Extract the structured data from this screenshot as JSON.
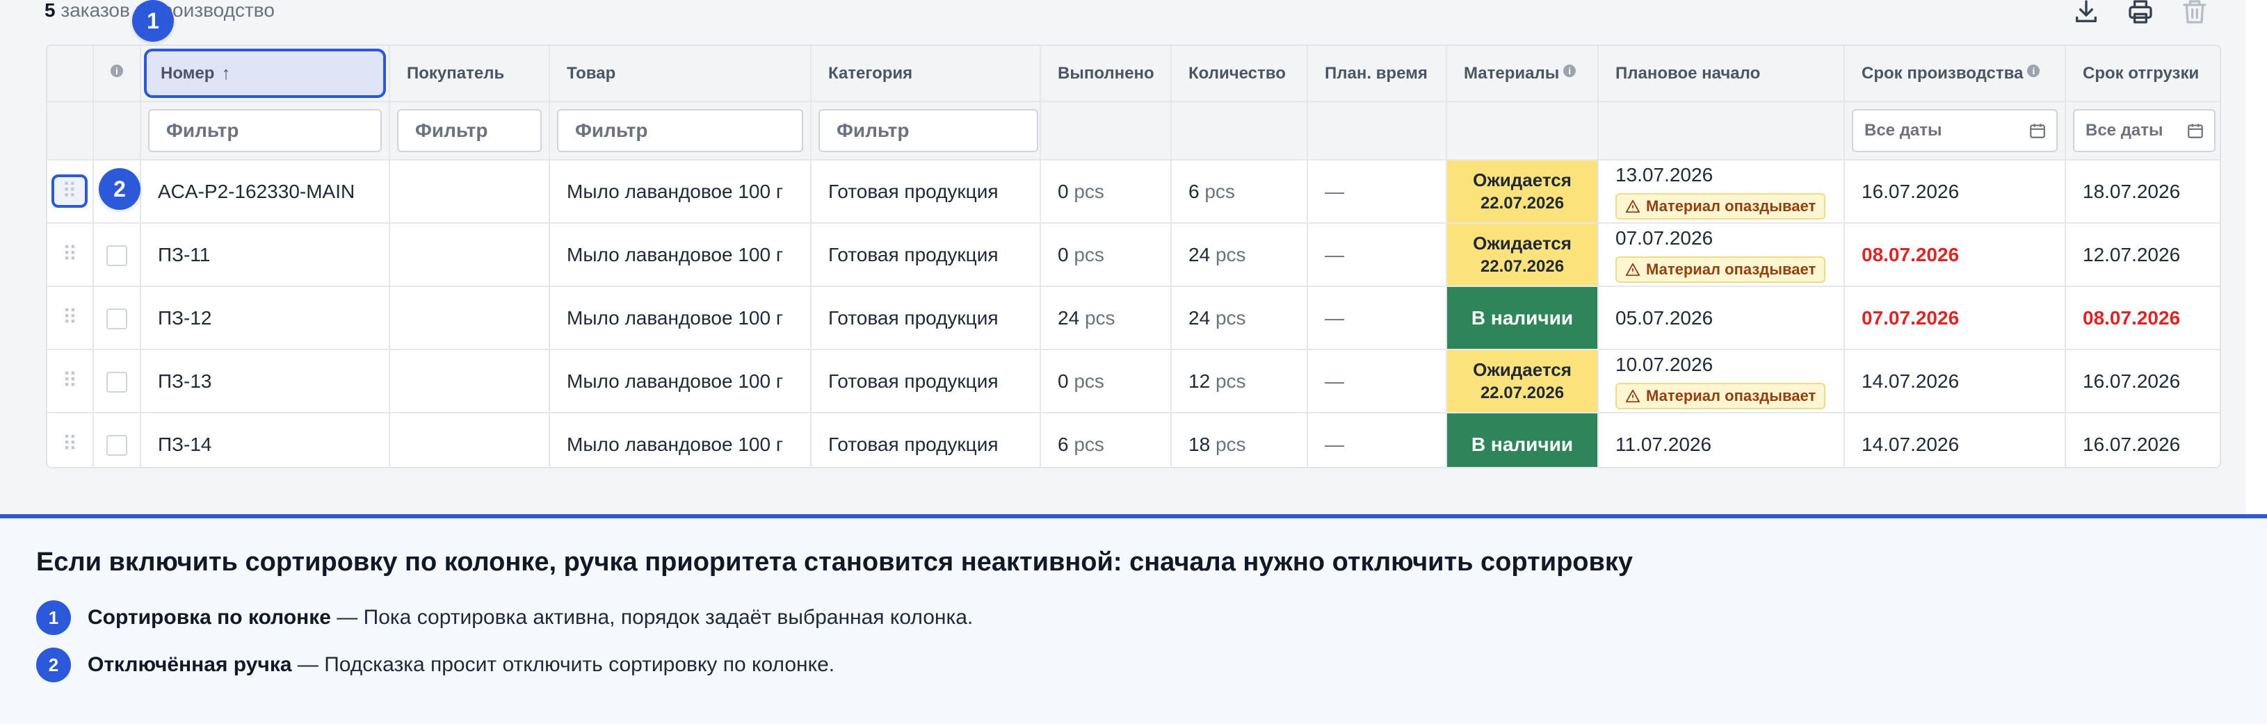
{
  "summary": {
    "count": "5",
    "label": "заказов в производство"
  },
  "columns": {
    "number": "Номер",
    "buyer": "Покупатель",
    "product": "Товар",
    "category": "Категория",
    "done": "Выполнено",
    "qty": "Количество",
    "plan_time": "План. время",
    "materials": "Материалы",
    "plan_start": "Плановое начало",
    "prod_deadline": "Срок производства",
    "ship_deadline": "Срок отгрузки"
  },
  "sort_arrow": "↑",
  "filters": {
    "placeholder": "Фильтр",
    "date_all": "Все даты"
  },
  "unit": "pcs",
  "rows": [
    {
      "number": "ACA-P2-162330-MAIN",
      "buyer": "",
      "product": "Мыло лавандовое 100 г",
      "category": "Готовая продукция",
      "done": "0",
      "qty": "6",
      "plan_time": "—",
      "mat_status": "Ожидается",
      "mat_date": "22.07.2026",
      "mat_kind": "wait",
      "start": "13.07.2026",
      "late": "Материал опаздывает",
      "prod": "16.07.2026",
      "prod_red": false,
      "ship": "18.07.2026",
      "ship_red": false
    },
    {
      "number": "ПЗ-11",
      "buyer": "",
      "product": "Мыло лавандовое 100 г",
      "category": "Готовая продукция",
      "done": "0",
      "qty": "24",
      "plan_time": "—",
      "mat_status": "Ожидается",
      "mat_date": "22.07.2026",
      "mat_kind": "wait",
      "start": "07.07.2026",
      "late": "Материал опаздывает",
      "prod": "08.07.2026",
      "prod_red": true,
      "ship": "12.07.2026",
      "ship_red": false
    },
    {
      "number": "ПЗ-12",
      "buyer": "",
      "product": "Мыло лавандовое 100 г",
      "category": "Готовая продукция",
      "done": "24",
      "qty": "24",
      "plan_time": "—",
      "mat_status": "В наличии",
      "mat_date": "",
      "mat_kind": "ok",
      "start": "05.07.2026",
      "late": "",
      "prod": "07.07.2026",
      "prod_red": true,
      "ship": "08.07.2026",
      "ship_red": true
    },
    {
      "number": "ПЗ-13",
      "buyer": "",
      "product": "Мыло лавандовое 100 г",
      "category": "Готовая продукция",
      "done": "0",
      "qty": "12",
      "plan_time": "—",
      "mat_status": "Ожидается",
      "mat_date": "22.07.2026",
      "mat_kind": "wait",
      "start": "10.07.2026",
      "late": "Материал опаздывает",
      "prod": "14.07.2026",
      "prod_red": false,
      "ship": "16.07.2026",
      "ship_red": false
    },
    {
      "number": "ПЗ-14",
      "buyer": "",
      "product": "Мыло лавандовое 100 г",
      "category": "Готовая продукция",
      "done": "6",
      "qty": "18",
      "plan_time": "—",
      "mat_status": "В наличии",
      "mat_date": "",
      "mat_kind": "ok",
      "start": "11.07.2026",
      "late": "",
      "prod": "14.07.2026",
      "prod_red": false,
      "ship": "16.07.2026",
      "ship_red": false
    }
  ],
  "badges": {
    "one": "1",
    "two": "2"
  },
  "info": {
    "title": "Если включить сортировку по колонке, ручка приоритета становится неактивной: сначала нужно отключить сортировку",
    "items": [
      {
        "num": "1",
        "bold": "Сортировка по колонке",
        "text": " — Пока сортировка активна, порядок задаёт выбранная колонка."
      },
      {
        "num": "2",
        "bold": "Отключённая ручка",
        "text": " — Подсказка просит отключить сортировку по колонке."
      }
    ]
  },
  "colors": {
    "accent": "#2b59d9",
    "wait": "#fce27a",
    "ok": "#2f855a",
    "late_red": "#dc2626"
  }
}
